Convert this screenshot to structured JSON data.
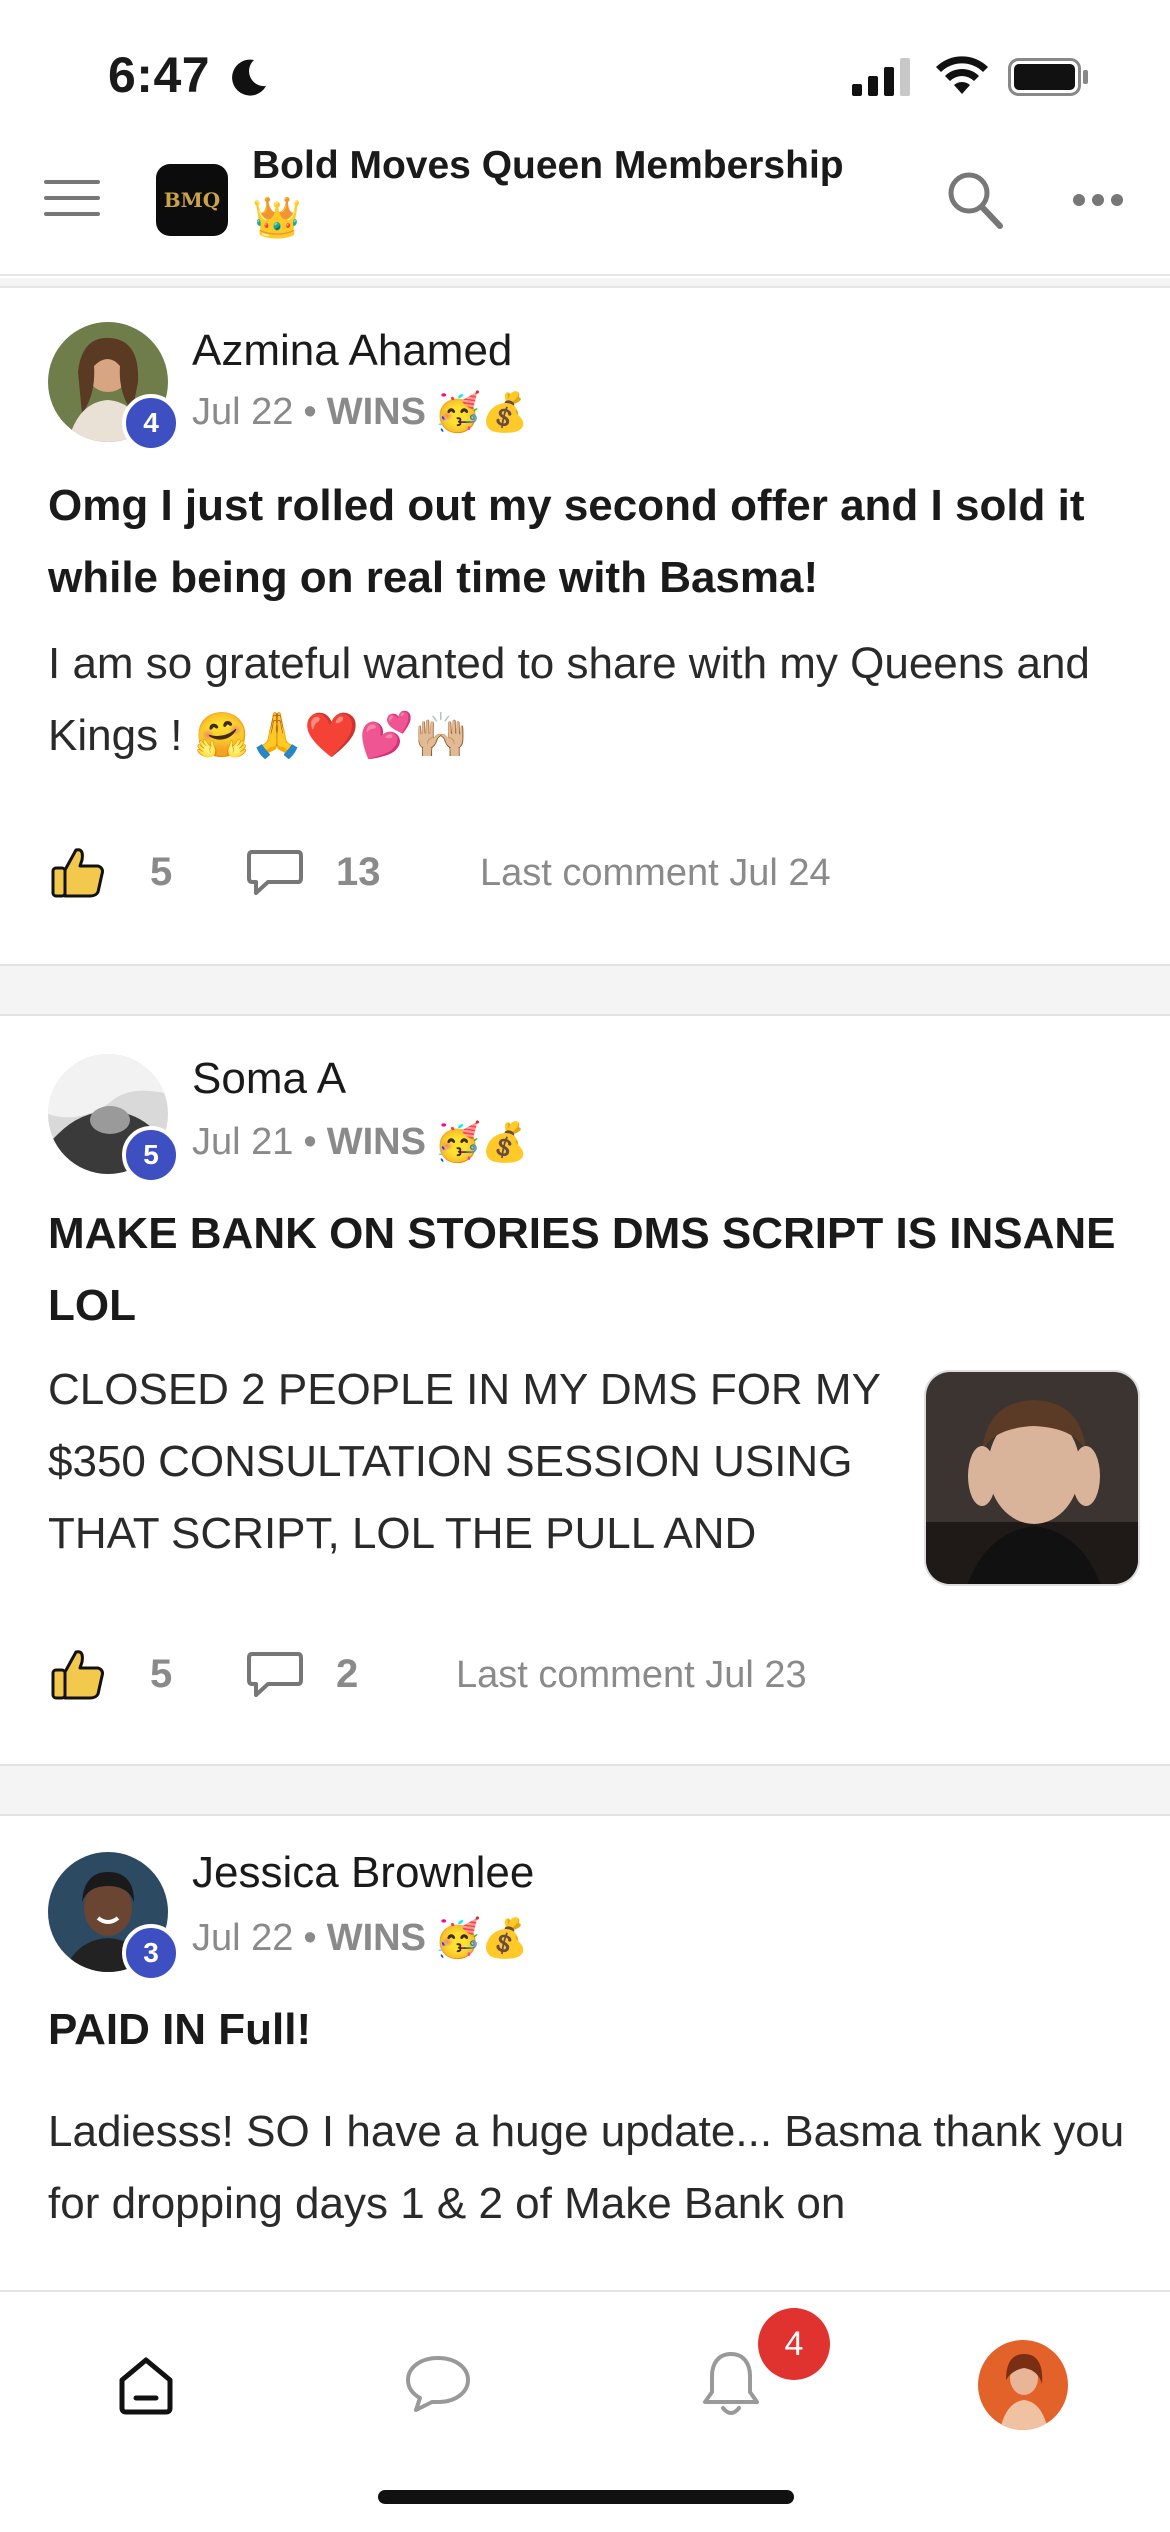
{
  "status_bar": {
    "time": "6:47"
  },
  "app": {
    "title": "Bold Moves Queen Membership",
    "title_emoji": "👑",
    "logo_text": "BMQ"
  },
  "posts": [
    {
      "author": "Azmina Ahamed",
      "level": "4",
      "date": "Jul 22",
      "separator": "•",
      "category": "WINS",
      "category_emoji": "🥳💰",
      "title": "Omg I just rolled out my second offer and I sold it while being on real time with Basma!",
      "body": "I am so grateful wanted to share with my Queens and Kings ! 🤗🙏❤️💕🙌🏼",
      "likes": "5",
      "comments": "13",
      "last_comment": "Last comment Jul 24"
    },
    {
      "author": "Soma A",
      "level": "5",
      "date": "Jul 21",
      "separator": "•",
      "category": "WINS",
      "category_emoji": "🥳💰",
      "title": "MAKE BANK ON STORIES DMS SCRIPT IS INSANE LOL",
      "body": "CLOSED 2 PEOPLE IN MY DMS FOR MY $350 CONSULTATION SESSION USING THAT SCRIPT, LOL THE PULL AND",
      "likes": "5",
      "comments": "2",
      "last_comment": "Last comment Jul 23"
    },
    {
      "author": "Jessica Brownlee",
      "level": "3",
      "date": "Jul 22",
      "separator": "•",
      "category": "WINS",
      "category_emoji": "🥳💰",
      "title": "PAID IN Full!",
      "body": "Ladiesss! SO I have a huge update... Basma thank you for dropping days 1 & 2 of Make Bank on"
    }
  ],
  "tab_bar": {
    "notification_count": "4"
  },
  "colors": {
    "badge_blue": "#3d4fc1",
    "notification_red": "#e0332f",
    "muted_text": "#8a8a8a"
  }
}
